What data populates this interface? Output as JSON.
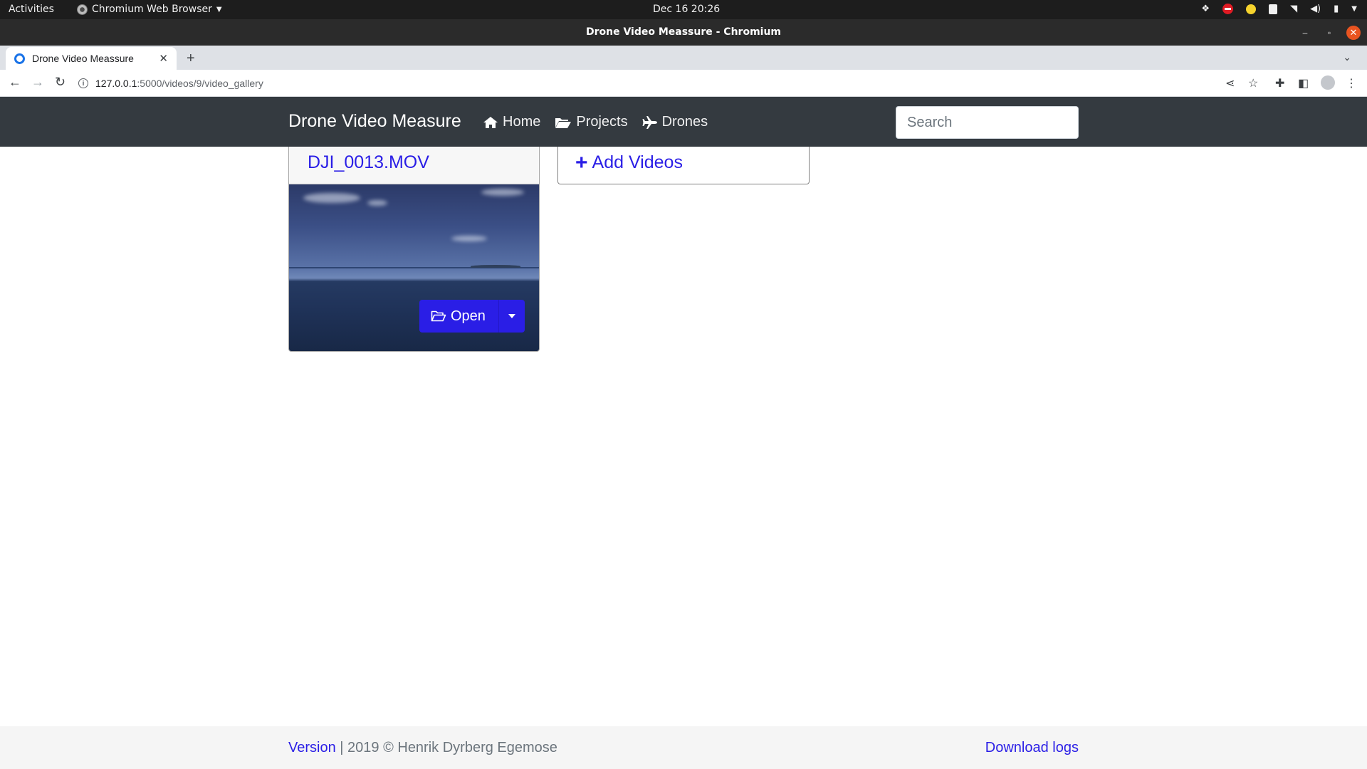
{
  "system": {
    "activities": "Activities",
    "app_menu": "Chromium Web Browser",
    "clock": "Dec 16  20:26"
  },
  "window": {
    "title": "Drone Video Meassure - Chromium"
  },
  "browser": {
    "tab_title": "Drone Video Meassure",
    "url_host": "127.0.0.1",
    "url_path": ":5000/videos/9/video_gallery"
  },
  "navbar": {
    "brand": "Drone Video Measure",
    "links": [
      {
        "label": "Home",
        "icon": "home-icon"
      },
      {
        "label": "Projects",
        "icon": "folder-open-icon"
      },
      {
        "label": "Drones",
        "icon": "plane-icon"
      }
    ],
    "search_placeholder": "Search"
  },
  "gallery": {
    "videos": [
      {
        "name": "DJI_0013.MOV",
        "open_label": "Open"
      }
    ],
    "add_label": "Add Videos"
  },
  "footer": {
    "version_link": "Version",
    "copyright": " | 2019 © Henrik Dyrberg Egemose",
    "download_logs": "Download logs"
  },
  "colors": {
    "navbar_bg": "#343a40",
    "link": "#2a1ee6",
    "button_primary": "#2a1ee6",
    "footer_bg": "#f5f5f5"
  }
}
